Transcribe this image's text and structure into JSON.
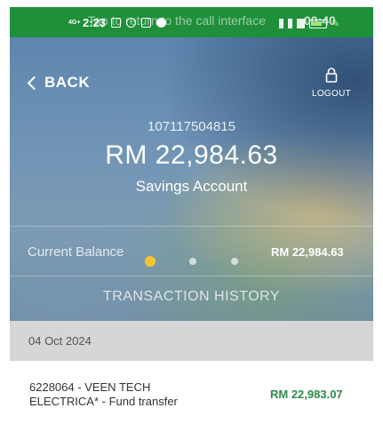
{
  "status_bar": {
    "network": "4G+",
    "time": "2:23",
    "call_banner": "Tap to return to the call interface",
    "call_timer": "00:40",
    "status_color": "#1f8f3a"
  },
  "header": {
    "back_label": "BACK",
    "back_icon": "chevron-left-icon",
    "logout_label": "LOGOUT",
    "logout_icon": "lock-icon"
  },
  "account": {
    "number": "107117504815",
    "amount": "RM 22,984.63",
    "type": "Savings Account"
  },
  "balance": {
    "label": "Current Balance",
    "value": "RM 22,984.63",
    "page_dots_total": 3,
    "page_dots_active": 1,
    "active_dot_color": "#f4c430"
  },
  "transaction_history_label": "TRANSACTION HISTORY",
  "transactions": {
    "date": "04 Oct 2024",
    "items": [
      {
        "description": "6228064 - VEEN TECH ELECTRICA* - Fund transfer",
        "amount": "RM 22,983.07",
        "amount_color": "#2e8b4a"
      }
    ]
  }
}
